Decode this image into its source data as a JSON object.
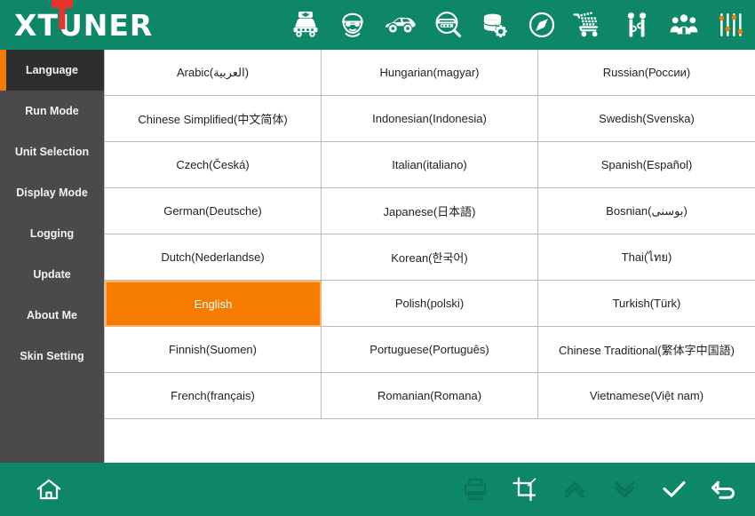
{
  "header": {
    "logo_text": "XTUNER",
    "logo_accent_color": "#e8342a",
    "background_color": "#0d8768",
    "icons": [
      {
        "name": "ambulance-icon",
        "label": "Ambulance"
      },
      {
        "name": "technician-face-icon",
        "label": "Technician"
      },
      {
        "name": "sports-car-icon",
        "label": "Sports Car"
      },
      {
        "name": "car-diagnostics-search-icon",
        "label": "Vehicle Diagnostics"
      },
      {
        "name": "database-settings-icon",
        "label": "Database Settings"
      },
      {
        "name": "compass-icon",
        "label": "Compass"
      },
      {
        "name": "shopping-cart-icon",
        "label": "Shop"
      },
      {
        "name": "people-connect-icon",
        "label": "Remote Assistance"
      },
      {
        "name": "user-group-icon",
        "label": "Community"
      },
      {
        "name": "sliders-settings-icon",
        "label": "Settings"
      }
    ]
  },
  "sidebar": {
    "background_color": "#4a4a4a",
    "active_color": "#2e2e2e",
    "accent_color": "#F57C00",
    "active_index": 0,
    "items": [
      {
        "label": "Language"
      },
      {
        "label": "Run Mode"
      },
      {
        "label": "Unit Selection"
      },
      {
        "label": "Display Mode"
      },
      {
        "label": "Logging"
      },
      {
        "label": "Update"
      },
      {
        "label": "About Me"
      },
      {
        "label": "Skin Setting"
      }
    ]
  },
  "main": {
    "selected_language": "English",
    "selected_color": "#F57C00",
    "languages": [
      "Arabic(العربية)",
      "Hungarian(magyar)",
      "Russian(России)",
      "Chinese Simplified(中文简体)",
      "Indonesian(Indonesia)",
      "Swedish(Svenska)",
      "Czech(Česká)",
      "Italian(italiano)",
      "Spanish(Español)",
      "German(Deutsche)",
      "Japanese(日本語)",
      "Bosnian(بوسنی)",
      "Dutch(Nederlandse)",
      "Korean(한국어)",
      "Thai(ไทย)",
      "English",
      "Polish(polski)",
      "Turkish(Türk)",
      "Finnish(Suomen)",
      "Portuguese(Português)",
      "Chinese Traditional(繁体字中国語)",
      "French(français)",
      "Romanian(Romana)",
      "Vietnamese(Việt nam)"
    ]
  },
  "footer": {
    "background_color": "#0d8768",
    "left_icons": [
      {
        "name": "home-icon",
        "label": "Home",
        "enabled": true
      }
    ],
    "right_icons": [
      {
        "name": "printer-icon",
        "label": "Print",
        "enabled": false
      },
      {
        "name": "screenshot-crop-icon",
        "label": "Screenshot",
        "enabled": true
      },
      {
        "name": "double-chevron-up-icon",
        "label": "Page Up",
        "enabled": false
      },
      {
        "name": "double-chevron-down-icon",
        "label": "Page Down",
        "enabled": false
      },
      {
        "name": "check-icon",
        "label": "Confirm",
        "enabled": true
      },
      {
        "name": "back-arrow-icon",
        "label": "Back",
        "enabled": true
      }
    ]
  }
}
